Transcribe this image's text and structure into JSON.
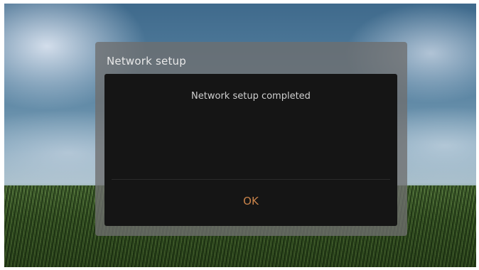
{
  "dialog": {
    "title": "Network setup",
    "message": "Network setup completed",
    "ok_label": "OK",
    "accent_color": "#c9834a"
  }
}
